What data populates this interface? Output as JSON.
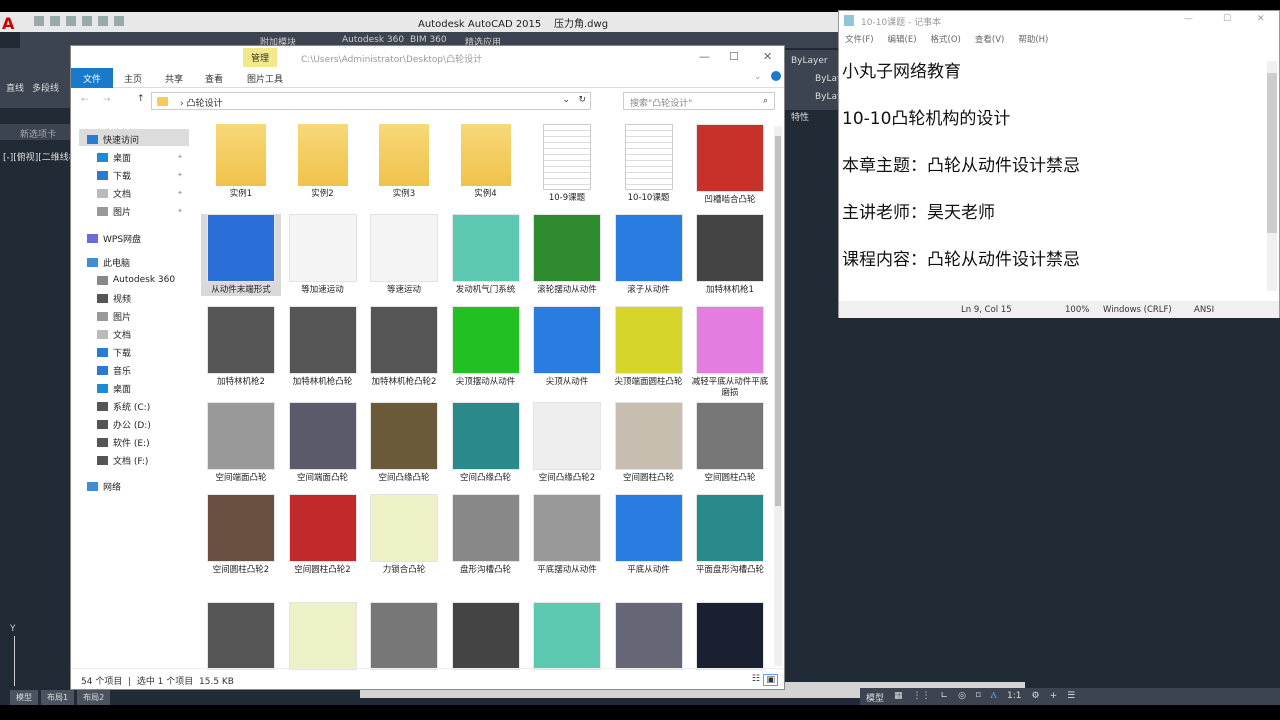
{
  "autocad": {
    "title": "Autodesk AutoCAD 2015",
    "file": "压力角.dwg",
    "ribbon_tabs": [
      "附加模块",
      "Autodesk 360",
      "BIM 360",
      "精选应用"
    ],
    "tools": [
      "直线",
      "多段线"
    ],
    "new_tab": "新选项卡",
    "viewport_label": "[-][俯视][二维线框]",
    "bylayer": [
      "ByLayer",
      "ByLay",
      "ByLay"
    ],
    "properties": "特性",
    "layout_tabs": [
      "模型",
      "布局1",
      "布局2"
    ],
    "status_items": [
      "模型",
      "1:1"
    ],
    "ucs_y": "Y"
  },
  "explorer": {
    "path": "C:\\Users\\Administrator\\Desktop\\凸轮设计",
    "context_tab": "管理",
    "tabs": [
      "文件",
      "主页",
      "共享",
      "查看",
      "图片工具"
    ],
    "address": "凸轮设计",
    "search_placeholder": "搜索\"凸轮设计\"",
    "nav": [
      {
        "label": "快速访问",
        "color": "#2a7bd4",
        "selected": true
      },
      {
        "label": "桌面",
        "color": "#1f8ad8",
        "pin": true
      },
      {
        "label": "下载",
        "color": "#2a7bd4",
        "pin": true
      },
      {
        "label": "文档",
        "color": "#bbb",
        "pin": true
      },
      {
        "label": "图片",
        "color": "#999",
        "pin": true
      },
      {
        "label": "WPS网盘",
        "color": "#6a6adb"
      },
      {
        "label": "此电脑",
        "color": "#3a8fd8"
      },
      {
        "label": "Autodesk 360",
        "color": "#888"
      },
      {
        "label": "视频",
        "color": "#555"
      },
      {
        "label": "图片",
        "color": "#999"
      },
      {
        "label": "文档",
        "color": "#bbb"
      },
      {
        "label": "下载",
        "color": "#2a7bd4"
      },
      {
        "label": "音乐",
        "color": "#2a7bd4"
      },
      {
        "label": "桌面",
        "color": "#1f8ad8"
      },
      {
        "label": "系统 (C:)",
        "color": "#555"
      },
      {
        "label": "办公 (D:)",
        "color": "#555"
      },
      {
        "label": "软件 (E:)",
        "color": "#555"
      },
      {
        "label": "文档 (F:)",
        "color": "#555"
      },
      {
        "label": "网络",
        "color": "#3a8fd8"
      }
    ],
    "items": [
      {
        "name": "实例1",
        "kind": "folder"
      },
      {
        "name": "实例2",
        "kind": "folder"
      },
      {
        "name": "实例3",
        "kind": "folder"
      },
      {
        "name": "实例4",
        "kind": "folder"
      },
      {
        "name": "10-9课题",
        "kind": "doc"
      },
      {
        "name": "10-10课题",
        "kind": "doc"
      },
      {
        "name": "凹槽啮合凸轮",
        "kind": "img",
        "color": "#c8302a"
      },
      {
        "name": "从动件末端形式",
        "kind": "img",
        "color": "#2a6fd8",
        "selected": true
      },
      {
        "name": "等加速运动",
        "kind": "img",
        "color": "#f4f4f4"
      },
      {
        "name": "等速运动",
        "kind": "img",
        "color": "#f4f4f4"
      },
      {
        "name": "发动机气门系统",
        "kind": "img",
        "color": "#5cc8b0"
      },
      {
        "name": "滚轮摆动从动件",
        "kind": "img",
        "color": "#2e8a2e"
      },
      {
        "name": "滚子从动件",
        "kind": "img",
        "color": "#2a7de0"
      },
      {
        "name": "加特林机枪1",
        "kind": "img",
        "color": "#444"
      },
      {
        "name": "加特林机枪2",
        "kind": "img",
        "color": "#555"
      },
      {
        "name": "加特林机枪凸轮",
        "kind": "img",
        "color": "#555"
      },
      {
        "name": "加特林机枪凸轮2",
        "kind": "img",
        "color": "#555"
      },
      {
        "name": "尖顶摆动从动件",
        "kind": "img",
        "color": "#22c022"
      },
      {
        "name": "尖顶从动件",
        "kind": "img",
        "color": "#2a7de0"
      },
      {
        "name": "尖顶端面圆柱凸轮",
        "kind": "img",
        "color": "#d6d62a"
      },
      {
        "name": "减轻平底从动件平底磨损",
        "kind": "img",
        "color": "#e37ee0"
      },
      {
        "name": "空间端面凸轮",
        "kind": "img",
        "color": "#999"
      },
      {
        "name": "空间端面凸轮",
        "kind": "img",
        "color": "#5a5a6a"
      },
      {
        "name": "空间凸缘凸轮",
        "kind": "img",
        "color": "#6a5a3a"
      },
      {
        "name": "空间凸缘凸轮",
        "kind": "img",
        "color": "#2a8a8a"
      },
      {
        "name": "空间凸缘凸轮2",
        "kind": "img",
        "color": "#eee"
      },
      {
        "name": "空间圆柱凸轮",
        "kind": "img",
        "color": "#c8beb0"
      },
      {
        "name": "空间圆柱凸轮",
        "kind": "img",
        "color": "#777"
      },
      {
        "name": "空间圆柱凸轮2",
        "kind": "img",
        "color": "#6a5040"
      },
      {
        "name": "空间圆柱凸轮2",
        "kind": "img",
        "color": "#c02a2a"
      },
      {
        "name": "力锁合凸轮",
        "kind": "img",
        "color": "#eef0c8"
      },
      {
        "name": "盘形沟槽凸轮",
        "kind": "img",
        "color": "#888"
      },
      {
        "name": "平底摆动从动件",
        "kind": "img",
        "color": "#999"
      },
      {
        "name": "平底从动件",
        "kind": "img",
        "color": "#2a7de0"
      },
      {
        "name": "平面盘形沟槽凸轮",
        "kind": "img",
        "color": "#2a8a8a"
      },
      {
        "name": "",
        "kind": "img",
        "color": "#555"
      },
      {
        "name": "",
        "kind": "img",
        "color": "#eef0c8"
      },
      {
        "name": "",
        "kind": "img",
        "color": "#777"
      },
      {
        "name": "",
        "kind": "img",
        "color": "#444"
      },
      {
        "name": "",
        "kind": "img",
        "color": "#5cc8b0"
      },
      {
        "name": "",
        "kind": "img",
        "color": "#667"
      },
      {
        "name": "",
        "kind": "img",
        "color": "#1a2030"
      }
    ],
    "status": {
      "count": "54 个项目",
      "selected": "选中 1 个项目",
      "size": "15.5 KB"
    }
  },
  "notepad": {
    "title": "10-10课题 - 记事本",
    "menu": [
      "文件(F)",
      "编辑(E)",
      "格式(O)",
      "查看(V)",
      "帮助(H)"
    ],
    "lines": [
      "小丸子网络教育",
      "10-10凸轮机构的设计",
      "本章主题：凸轮从动件设计禁忌",
      "主讲老师：昊天老师",
      "课程内容：凸轮从动件设计禁忌"
    ],
    "status": {
      "position": "Ln 9, Col 15",
      "zoom": "100%",
      "eol": "Windows (CRLF)",
      "encoding": "ANSI"
    }
  }
}
